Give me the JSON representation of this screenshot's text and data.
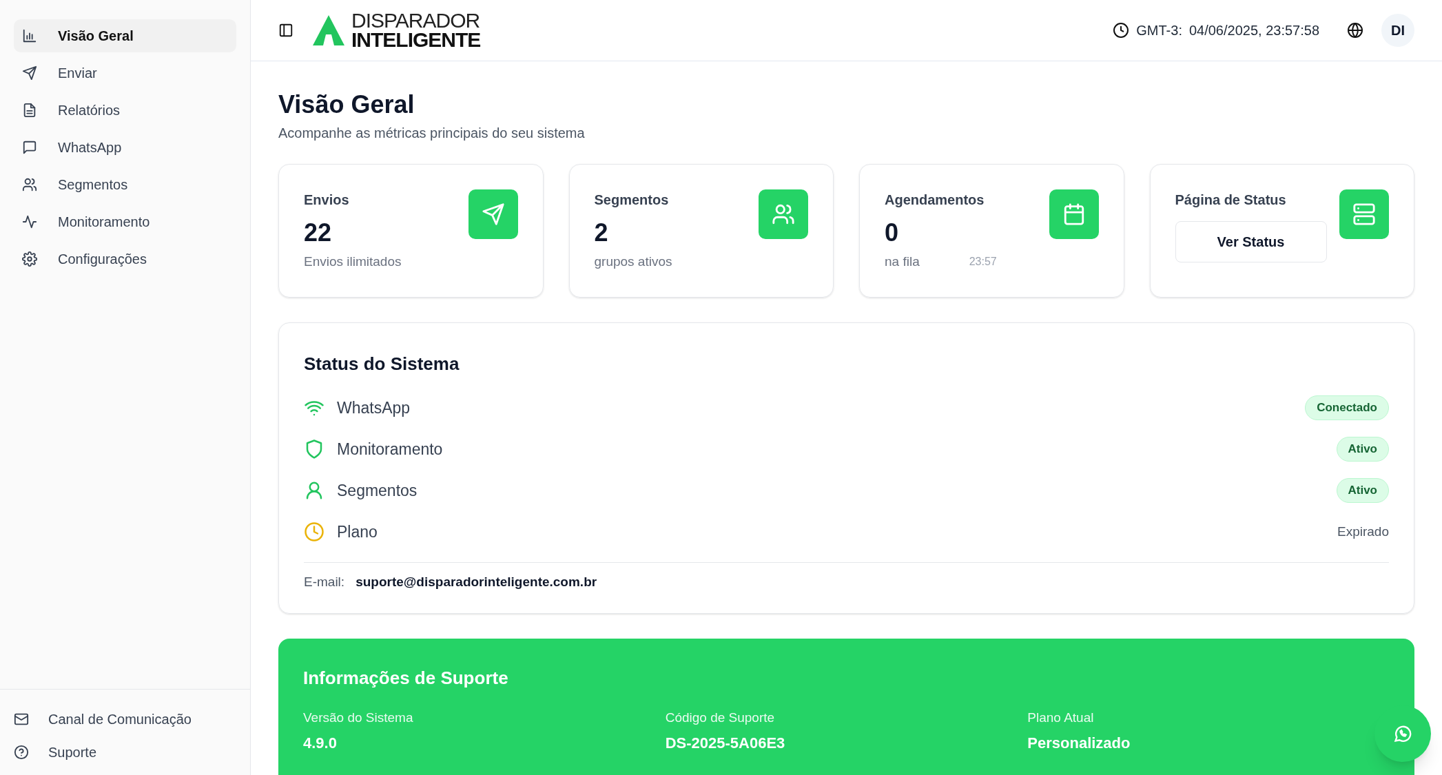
{
  "sidebar": {
    "items": [
      {
        "label": "Visão Geral",
        "selected": true
      },
      {
        "label": "Enviar",
        "selected": false
      },
      {
        "label": "Relatórios",
        "selected": false
      },
      {
        "label": "WhatsApp",
        "selected": false
      },
      {
        "label": "Segmentos",
        "selected": false
      },
      {
        "label": "Monitoramento",
        "selected": false
      },
      {
        "label": "Configurações",
        "selected": false
      }
    ],
    "footer_items": [
      {
        "label": "Canal de Comunicação"
      },
      {
        "label": "Suporte"
      }
    ]
  },
  "header": {
    "logo_top": "DISPARADOR",
    "logo_bottom": "INTELIGENTE",
    "timezone": "GMT-3:",
    "datetime": "04/06/2025, 23:57:58",
    "avatar": "DI"
  },
  "page": {
    "title": "Visão Geral",
    "subtitle": "Acompanhe as métricas principais do seu sistema"
  },
  "cards": [
    {
      "kind": "metric",
      "label": "Envios",
      "value": "22",
      "caption": "Envios ilimitados"
    },
    {
      "kind": "metric",
      "label": "Segmentos",
      "value": "2",
      "caption": "grupos ativos"
    },
    {
      "kind": "metric",
      "label": "Agendamentos",
      "value": "0",
      "caption": "na fila",
      "time": "23:57"
    },
    {
      "kind": "button",
      "label": "Página de Status",
      "button": "Ver Status"
    }
  ],
  "system_status": {
    "title": "Status do Sistema",
    "rows": [
      {
        "label": "WhatsApp",
        "status": "Conectado",
        "kind": "badge",
        "color": "#22c55e"
      },
      {
        "label": "Monitoramento",
        "status": "Ativo",
        "kind": "badge",
        "color": "#22c55e"
      },
      {
        "label": "Segmentos",
        "status": "Ativo",
        "kind": "badge",
        "color": "#22c55e"
      },
      {
        "label": "Plano",
        "status": "Expirado",
        "kind": "text",
        "color": "#eab308"
      }
    ],
    "email_label": "E-mail:",
    "email": "suporte@disparadorinteligente.com.br"
  },
  "support": {
    "title": "Informações de Suporte",
    "fields": [
      {
        "label": "Versão do Sistema",
        "value": "4.9.0"
      },
      {
        "label": "Código de Suporte",
        "value": "DS-2025-5A06E3"
      },
      {
        "label": "Plano Atual",
        "value": "Personalizado"
      }
    ]
  }
}
